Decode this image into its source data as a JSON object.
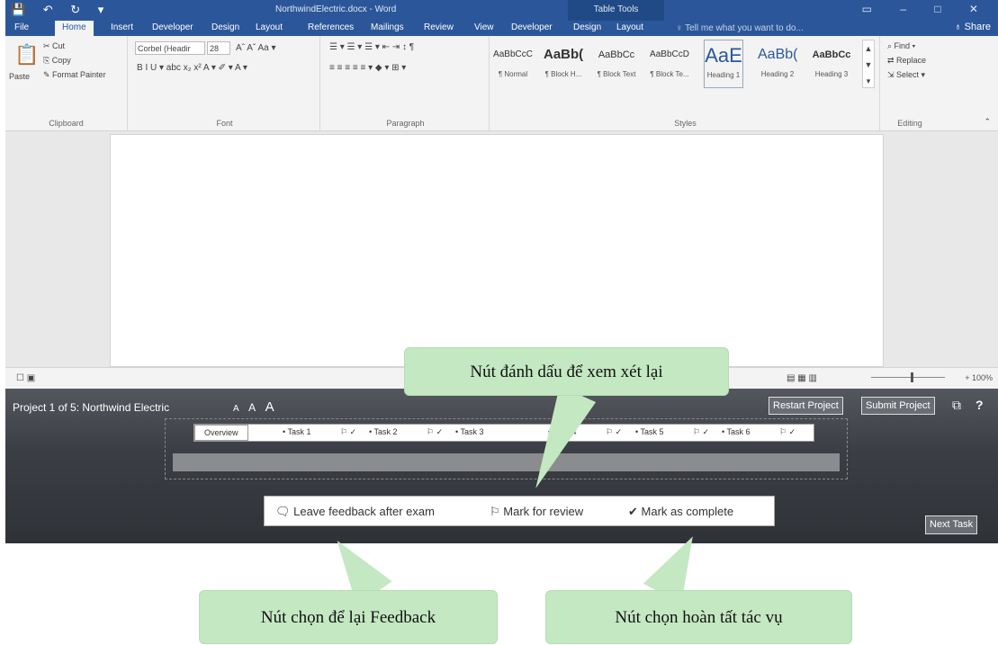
{
  "titlebar": {
    "qat": "💾 ↶ ↻ ▾",
    "doc_title": "NorthwindElectric.docx - Word",
    "table_tools": "Table Tools",
    "window_controls": "▭ – □ ✕"
  },
  "tabs": {
    "file": "File",
    "home": "Home",
    "insert": "Insert",
    "developer": "Developer",
    "design": "Design",
    "layout": "Layout",
    "references": "References",
    "mailings": "Mailings",
    "review": "Review",
    "view": "View",
    "developer2": "Developer",
    "design2": "Design",
    "layout2": "Layout"
  },
  "tell_me": "♀ Tell me what you want to do...",
  "share": "♁ Share",
  "clipboard": {
    "paste": "Paste",
    "cut": "✂ Cut",
    "copy": "⎘ Copy",
    "format_painter": "✎ Format Painter",
    "label": "Clipboard"
  },
  "font": {
    "name": "Corbel (Headir",
    "size": "28",
    "grow_shrink": "Aˆ Aˇ  Aa ▾",
    "formatting": "B  I  U ▾ abc x₂ x²  A ▾  ✐ ▾  A ▾",
    "label": "Font"
  },
  "paragraph": {
    "row1": "☰ ▾ ☰ ▾ ☰ ▾  ⇤ ⇥  ↕  ¶",
    "row2": "≡  ≡  ≡  ≡   ≡ ▾  ◆ ▾ ⊞ ▾",
    "label": "Paragraph"
  },
  "styles": {
    "items": [
      {
        "sample": "AaBbCcC",
        "name": "¶ Normal"
      },
      {
        "sample": "AaBb(",
        "name": "¶ Block H..."
      },
      {
        "sample": "AaBbCc",
        "name": "¶ Block Text"
      },
      {
        "sample": "AaBbCcD",
        "name": "¶ Block Te..."
      },
      {
        "sample": "AaE",
        "name": "Heading 1"
      },
      {
        "sample": "AaBb(",
        "name": "Heading 2"
      },
      {
        "sample": "AaBbCc",
        "name": "Heading 3"
      }
    ],
    "label": "Styles"
  },
  "editing": {
    "find": "⌕ Find ▾",
    "replace": "⇄ Replace",
    "select": "⇲ Select ▾",
    "label": "Editing"
  },
  "statusbar": {
    "left": "☐  ▣",
    "views": "▤  ▦  ▥",
    "zoom": "+ 100%"
  },
  "exam": {
    "project_title": "Project 1 of 5: Northwind Electric",
    "font_small": "A",
    "font_mid": "A",
    "font_large": "A",
    "restart": "Restart Project",
    "submit": "Submit Project",
    "help": "?",
    "tabs": [
      "Overview",
      "• Task 1",
      "⚐ ✓",
      "• Task 2",
      "⚐ ✓",
      "• Task 3",
      "• Task 4",
      "⚐ ✓",
      "• Task 5",
      "⚐ ✓",
      "• Task 6",
      "⚐ ✓"
    ],
    "feedback": "🗨 Leave feedback after exam",
    "mark_review": "⚐ Mark for review",
    "mark_complete": "✔ Mark as complete",
    "next_task": "Next Task"
  },
  "callouts": {
    "review": "Nút đánh dấu để xem xét lại",
    "feedback": "Nút chọn để lại Feedback",
    "complete": "Nút chọn hoàn tất tác vụ"
  },
  "colors": {
    "word_blue": "#2b579a",
    "callout_green": "#c4e8c2"
  }
}
